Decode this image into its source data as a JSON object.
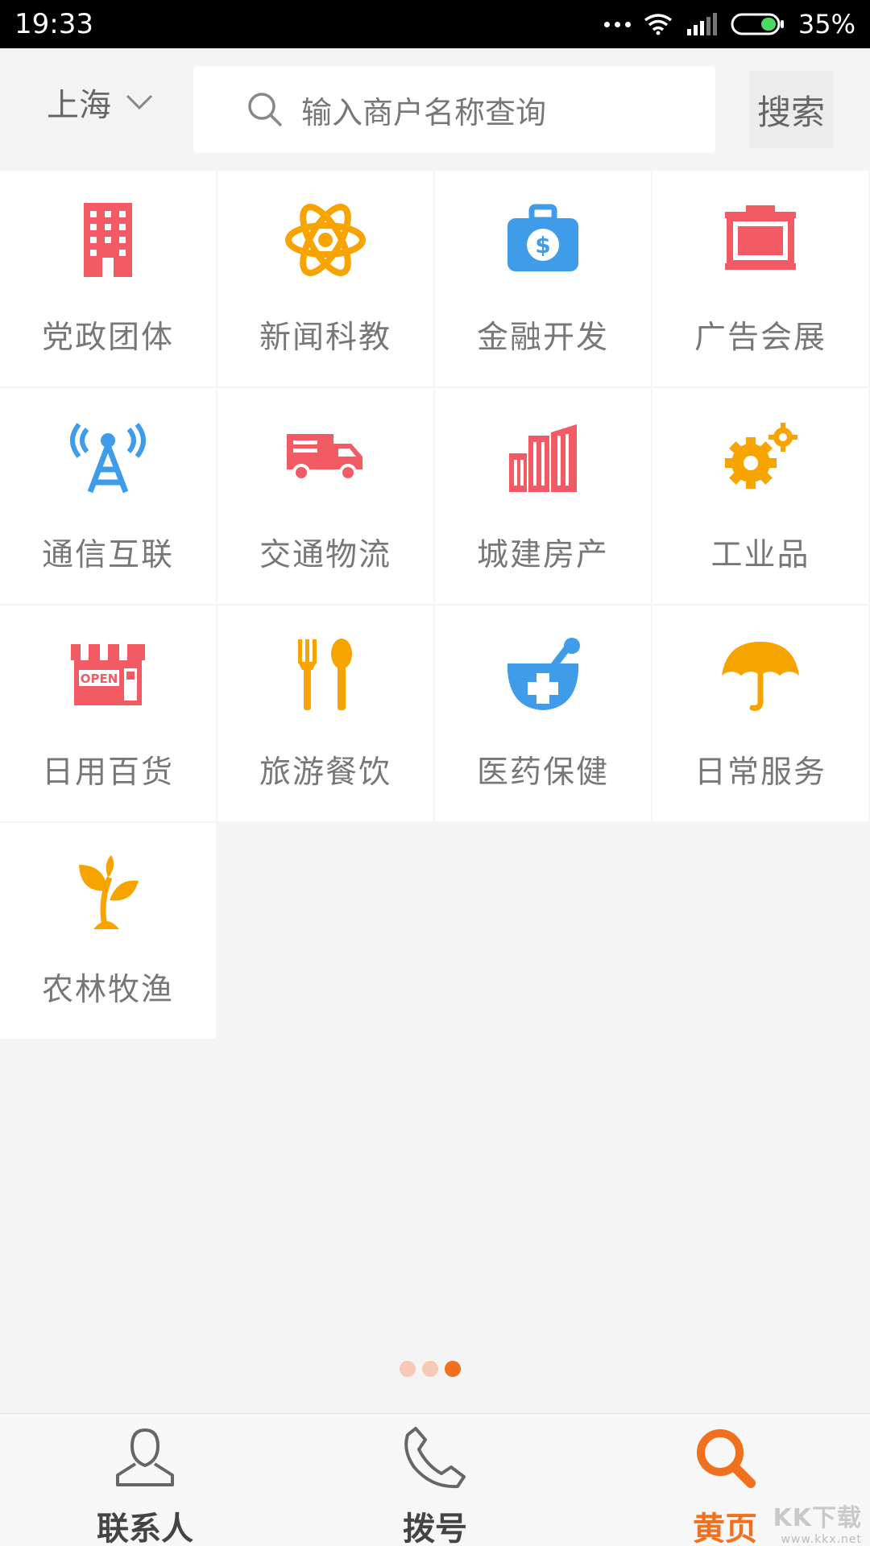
{
  "status_bar": {
    "time": "19:33",
    "battery": "35%"
  },
  "header": {
    "city": "上海",
    "search_placeholder": "输入商户名称查询",
    "search_button": "搜索"
  },
  "categories": [
    {
      "label": "党政团体",
      "icon": "building-icon"
    },
    {
      "label": "新闻科教",
      "icon": "atom-icon"
    },
    {
      "label": "金融开发",
      "icon": "money-case-icon"
    },
    {
      "label": "广告会展",
      "icon": "billboard-icon"
    },
    {
      "label": "通信互联",
      "icon": "signal-tower-icon"
    },
    {
      "label": "交通物流",
      "icon": "truck-icon"
    },
    {
      "label": "城建房产",
      "icon": "city-buildings-icon"
    },
    {
      "label": "工业品",
      "icon": "gears-icon"
    },
    {
      "label": "日用百货",
      "icon": "open-shop-icon"
    },
    {
      "label": "旅游餐饮",
      "icon": "fork-spoon-icon"
    },
    {
      "label": "医药保健",
      "icon": "mortar-cross-icon"
    },
    {
      "label": "日常服务",
      "icon": "umbrella-icon"
    },
    {
      "label": "农林牧渔",
      "icon": "sprout-icon"
    }
  ],
  "pager": {
    "count": 3,
    "active_index": 2
  },
  "bottom_nav": [
    {
      "label": "联系人",
      "icon": "contact-person-icon"
    },
    {
      "label": "拨号",
      "icon": "phone-icon"
    },
    {
      "label": "黄页",
      "icon": "search-icon"
    }
  ],
  "colors": {
    "accent": "#f07020",
    "red": "#f25a64",
    "orange": "#f7a400",
    "blue": "#3f9ce8"
  },
  "watermark": {
    "text": "KK下载",
    "sub": "www.kkx.net"
  }
}
